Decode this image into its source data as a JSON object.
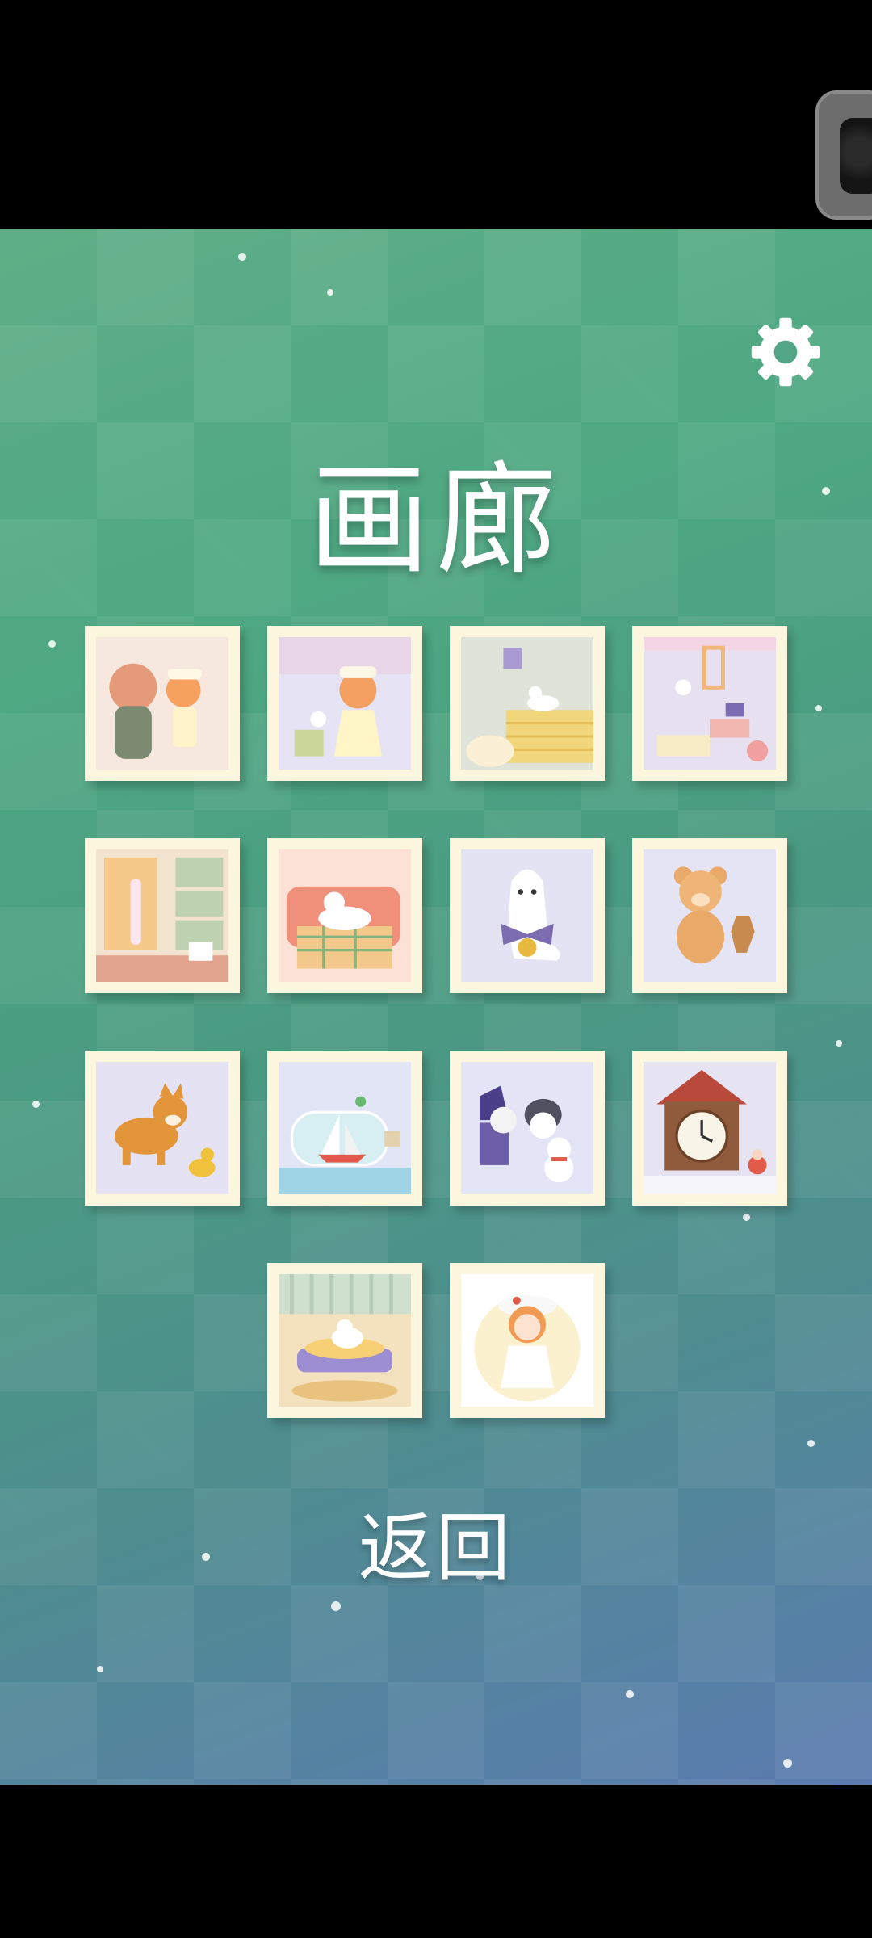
{
  "screen": {
    "title": "画廊",
    "back_label": "返回"
  },
  "colors": {
    "bg_top": "#5fae87",
    "bg_bottom": "#5b7bb0",
    "tile_frame": "#fdf6df"
  },
  "icons": {
    "settings": "gear-icon"
  },
  "gallery": {
    "items": [
      {
        "name": "girl-with-mirror"
      },
      {
        "name": "girl-with-cat-toy"
      },
      {
        "name": "cat-on-wall"
      },
      {
        "name": "cats-in-shop"
      },
      {
        "name": "cat-at-window"
      },
      {
        "name": "cat-on-sofa"
      },
      {
        "name": "ghost-cat-with-bell"
      },
      {
        "name": "teddy-bear"
      },
      {
        "name": "shiba-dog"
      },
      {
        "name": "ship-in-bottle"
      },
      {
        "name": "penguin-and-snowman"
      },
      {
        "name": "cuckoo-clock"
      },
      {
        "name": "cat-on-cushion"
      },
      {
        "name": "girl-in-white"
      }
    ]
  }
}
